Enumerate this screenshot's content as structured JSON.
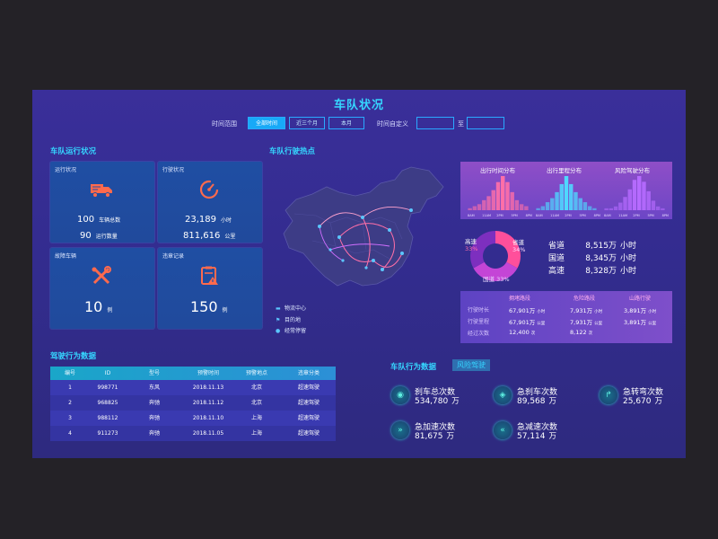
{
  "title": "车队状况",
  "filters": {
    "range_label": "时间范围",
    "buttons": [
      "全部时间",
      "近三个月",
      "本月"
    ],
    "custom_label": "时间自定义",
    "to_label": "至"
  },
  "fleet_status": {
    "title": "车队运行状况",
    "cards": [
      {
        "label": "运行状况",
        "icon": "truck-icon",
        "rows": [
          {
            "value": "100",
            "unit": "车辆总数"
          },
          {
            "value": "90",
            "unit": "运行数量"
          }
        ]
      },
      {
        "label": "行驶状况",
        "icon": "speedometer-icon",
        "rows": [
          {
            "value": "23,189",
            "unit": "小时"
          },
          {
            "value": "811,616",
            "unit": "公里"
          }
        ]
      },
      {
        "label": "故障车辆",
        "icon": "tools-icon",
        "rows": [
          {
            "value": "10",
            "unit": "例"
          }
        ]
      },
      {
        "label": "违章记录",
        "icon": "clipboard-warning-icon",
        "rows": [
          {
            "value": "150",
            "unit": "例"
          }
        ]
      }
    ]
  },
  "hotspots": {
    "title": "车队行驶热点",
    "legend": [
      {
        "icon": "truck-icon",
        "label": "物流中心"
      },
      {
        "icon": "flag-icon",
        "label": "目的地"
      },
      {
        "icon": "pin-icon",
        "label": "经常停留"
      }
    ]
  },
  "distributions": {
    "titles": [
      "出行时间分布",
      "出行里程分布",
      "风险驾驶分布"
    ],
    "tick_labels": [
      "8AM",
      "11AM",
      "2PM",
      "5PM",
      "8PM"
    ],
    "series": [
      [
        1,
        2,
        3,
        5,
        7,
        10,
        14,
        17,
        14,
        9,
        5,
        3,
        2
      ],
      [
        1,
        2,
        4,
        6,
        9,
        13,
        17,
        13,
        9,
        6,
        4,
        2,
        1
      ],
      [
        1,
        1,
        2,
        4,
        7,
        11,
        16,
        18,
        15,
        10,
        5,
        2,
        1
      ]
    ],
    "colors": [
      "#ff6fa8",
      "#4fd8ff",
      "#b66bff"
    ]
  },
  "road_share": {
    "slices": [
      {
        "name": "高速",
        "percent": 33,
        "color": "#ff4f9b"
      },
      {
        "name": "省道",
        "percent": 34,
        "color": "#c445d6"
      },
      {
        "name": "国道",
        "percent": 33,
        "color": "#7d2fbf"
      }
    ],
    "rows": [
      {
        "name": "省道",
        "value": "8,515万",
        "unit": "小时"
      },
      {
        "name": "国道",
        "value": "8,345万",
        "unit": "小时"
      },
      {
        "name": "高速",
        "value": "8,328万",
        "unit": "小时"
      }
    ]
  },
  "road_stats": {
    "columns": [
      "拥堵路段",
      "危险路段",
      "山路行驶"
    ],
    "rows": [
      {
        "label": "行驶时长",
        "cells": [
          {
            "v": "67,901万",
            "u": "小时"
          },
          {
            "v": "7,931万",
            "u": "小时"
          },
          {
            "v": "3,891万",
            "u": "小时"
          }
        ]
      },
      {
        "label": "行驶里程",
        "cells": [
          {
            "v": "67,901万",
            "u": "公里"
          },
          {
            "v": "7,931万",
            "u": "公里"
          },
          {
            "v": "3,891万",
            "u": "公里"
          }
        ]
      },
      {
        "label": "经过次数",
        "cells": [
          {
            "v": "12,400",
            "u": "次"
          },
          {
            "v": "8,122",
            "u": "次"
          },
          {
            "v": "",
            "u": ""
          }
        ]
      }
    ]
  },
  "driving": {
    "title": "驾驶行为数据",
    "headers": [
      "编号",
      "ID",
      "型号",
      "预警时间",
      "预警地点",
      "违章分类"
    ],
    "rows": [
      [
        "1",
        "998771",
        "东风",
        "2018.11.13",
        "北京",
        "超速驾驶"
      ],
      [
        "2",
        "968825",
        "奔驰",
        "2018.11.12",
        "北京",
        "超速驾驶"
      ],
      [
        "3",
        "988112",
        "奔驰",
        "2018.11.10",
        "上海",
        "超速驾驶"
      ],
      [
        "4",
        "911273",
        "奔驰",
        "2018.11.05",
        "上海",
        "超速驾驶"
      ]
    ]
  },
  "behavior": {
    "title": "车队行为数据",
    "tag": "风险驾驶",
    "stats": [
      {
        "icon": "brake-icon",
        "label": "刹车总次数",
        "value": "534,780",
        "unit": "万"
      },
      {
        "icon": "hard-brake-icon",
        "label": "急刹车次数",
        "value": "89,568",
        "unit": "万"
      },
      {
        "icon": "sharp-turn-icon",
        "label": "急转弯次数",
        "value": "25,670",
        "unit": "万"
      },
      {
        "icon": "accelerate-icon",
        "label": "急加速次数",
        "value": "81,675",
        "unit": "万"
      },
      {
        "icon": "decelerate-icon",
        "label": "急减速次数",
        "value": "57,114",
        "unit": "万"
      }
    ]
  }
}
